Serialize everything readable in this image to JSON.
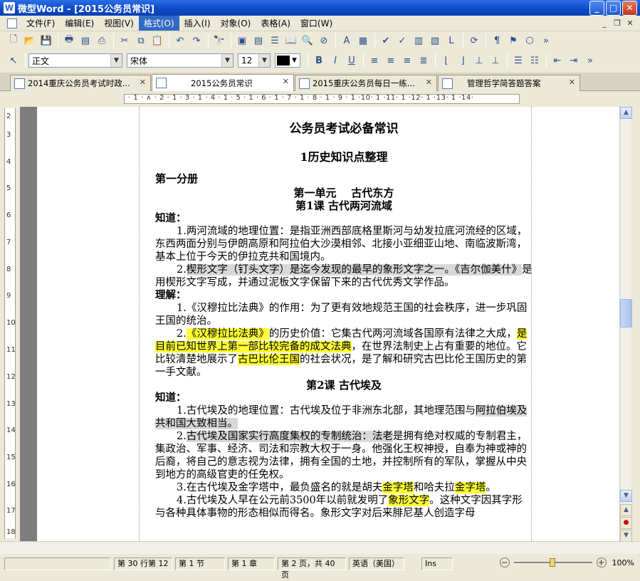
{
  "window": {
    "title": "微型Word - [2015公务员常识]",
    "app_icon": "W"
  },
  "menu": [
    "文件(F)",
    "编辑(E)",
    "视图(V)",
    "格式(O)",
    "插入(I)",
    "对象(O)",
    "表格(A)",
    "窗口(W)"
  ],
  "active_menu_index": 3,
  "formatting": {
    "style": "正文",
    "font": "宋体",
    "size": "12",
    "color": "#000000"
  },
  "tabs": [
    {
      "label": "2014重庆公务员考试时政..."
    },
    {
      "label": "2015公务员常识"
    },
    {
      "label": "2015重庆公务员每日一练..."
    },
    {
      "label": "管理哲学简答题答案"
    }
  ],
  "active_tab_index": 1,
  "ruler": {
    "numbers": "· 1 · ∧ · 2 · 1 · 3 · 1 · 4 · 1 · 5 · 1 · 6 · 1 · 7 · 1 · 8 · 1 · 9 · 1 ·10· 1 ·11· 1 ·12· 1 ·13· 1 ·14·"
  },
  "vruler_numbers": [
    "2",
    "3",
    "4",
    "5",
    "6",
    "7",
    "8",
    "9",
    "10",
    "11",
    "12",
    "13",
    "14",
    "15",
    "16",
    "17",
    "18"
  ],
  "document": {
    "title": "公务员考试必备常识",
    "section_title": "1历史知识点整理",
    "part": "第一分册",
    "unit": "第一单元    古代东方",
    "lesson1": "第1课  古代两河流域",
    "know1": "知道：",
    "p1": "1.两河流域的地理位置：是指亚洲西部底格里斯河与幼发拉底河流经的区域，",
    "p1b": "东西两面分别与伊朗高原和阿拉伯大沙漠相邻、北接小亚细亚山地、南临波斯湾，基本上位于今天的伊拉克共和国境内。",
    "p2a": "2.",
    "p2b": "楔形文字（钉头文字）是迄今发现的最早的象形文字之一。",
    "p2c": "《吉尔伽美什》",
    "p2d": "是用楔形文字写成，并通过泥板文字保留下来的古代优秀文学作品。",
    "understand": "理解：",
    "p3": "1.《汉穆拉比法典》的作用：为了更有效地规范王国的社会秩序，进一步巩固王国的统治。",
    "p4a": "2.",
    "p4b": "《汉穆拉比法典》",
    "p4c": "的历史价值：它集古代两河流域各国原有法律之大成，",
    "p4d": "是目前已知世界上第一部比较完备的成文法典",
    "p4e": "，在世界法制史上占有重要的地位。它比较清楚地展示了",
    "p4f": "古巴比伦王国",
    "p4g": "的社会状况，是了解和研究古巴比伦王国历史的第一手文献。",
    "lesson2": "第2课  古代埃及",
    "know2": "知道：",
    "p5a": "1.古代埃及的地理位置：古代埃及位于非洲东北部，其地理范围与",
    "p5b": "阿拉伯埃及共和国大致相当。",
    "p6a": "2.",
    "p6b": "古代埃及国家实行高度集权的专制统治：法老",
    "p6c": "是拥有绝对权威的专制君主，集政治、军事、经济、司法和宗教大权于一身。他强化王权神授，自奉为神或神的后裔，将自己的意志视为法律，拥有全国的土地，并控制所有的军队，掌握从中央到地方的高级官吏的任免权。",
    "p7a": "3.在古代埃及金字塔中，最负盛名的就是胡夫",
    "p7b": "金字塔",
    "p7c": "和哈夫拉",
    "p7d": "金字塔",
    "p7e": "。",
    "p8a": "4.古代埃及人早在公元前3500年以前就发明了",
    "p8b": "象形文字",
    "p8c": "。这种文字因其字形与各种具体事物的形态相似而得名。象形文字对后来腓尼基人创造字母"
  },
  "status": {
    "position": "第 30 行第 12",
    "section": "第 1 节",
    "chapter": "第 1 章",
    "page": "第 2 页，共 40 页",
    "language": "英语（美国）",
    "ins": "Ins",
    "zoom": "100%"
  }
}
